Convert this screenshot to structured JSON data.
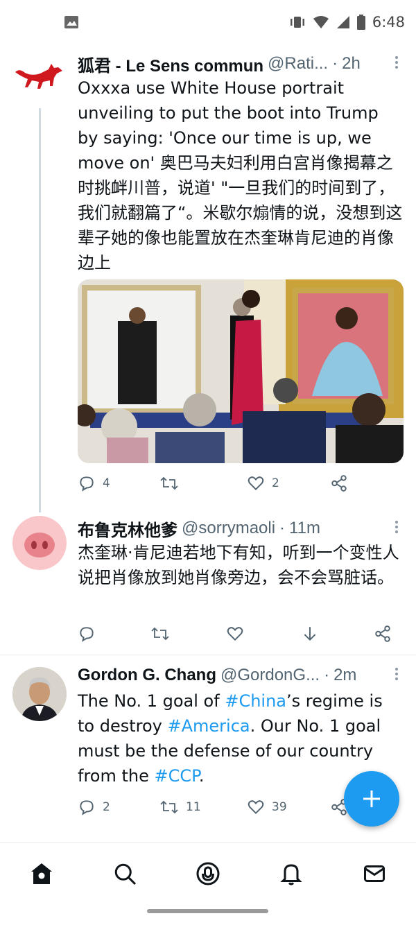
{
  "status_bar": {
    "time": "6:48",
    "icons": [
      "gallery-icon",
      "vibrate-icon",
      "wifi-icon",
      "signal-icon",
      "battery-icon"
    ]
  },
  "tweets": [
    {
      "author_name": "狐君 - Le Sens commun",
      "handle": "@Rati...",
      "time": "2h",
      "text": "Oxxxa use White House portrait unveiling to put the boot into Trump by saying: 'Once our time is up, we move on' 奥巴马夫妇利用白宫肖像揭幕之时挑衅川普，说道' \"一旦我们的时间到了，我们就翻篇了“。米歇尔煽情的说，没想到这辈子她的像也能置放在杰奎琳肯尼迪的肖像边上",
      "reply_count": "4",
      "retweet_count": "",
      "like_count": "2"
    },
    {
      "author_name": "布鲁克林他爹",
      "handle": "@sorrymaoli",
      "time": "11m",
      "text": "杰奎琳·肯尼迪若地下有知，听到一个变性人说把肖像放到她肖像旁边，会不会骂脏话。",
      "reply_count": "",
      "retweet_count": "",
      "like_count": ""
    },
    {
      "author_name": "Gordon G. Chang",
      "handle": "@GordonG...",
      "time": "2m",
      "text_parts": [
        "The No. 1 goal of ",
        "#China",
        "’s regime is to destroy ",
        "#America",
        ". Our No. 1 goal must be the defense of our country from the ",
        "#CCP",
        "."
      ],
      "reply_count": "2",
      "retweet_count": "11",
      "like_count": "39"
    }
  ],
  "colors": {
    "accent": "#1d9bf0",
    "text": "#0f1419",
    "muted": "#536471"
  },
  "bottom_nav": [
    "home-icon",
    "search-icon",
    "spaces-icon",
    "notifications-icon",
    "messages-icon"
  ]
}
